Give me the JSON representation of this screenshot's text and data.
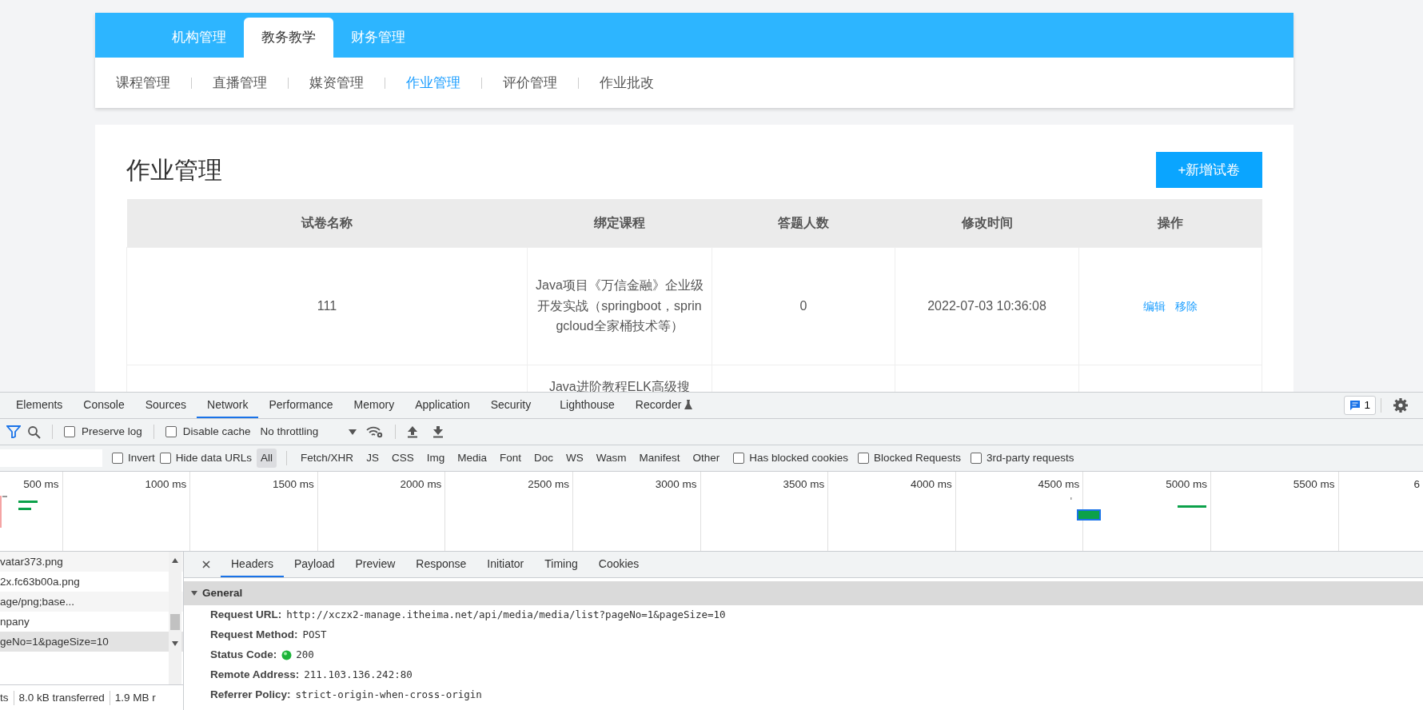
{
  "top_tabs": [
    {
      "label": "机构管理",
      "selected": false
    },
    {
      "label": "教务教学",
      "selected": true
    },
    {
      "label": "财务管理",
      "selected": false
    }
  ],
  "sub_nav": [
    {
      "label": "课程管理",
      "selected": false
    },
    {
      "label": "直播管理",
      "selected": false
    },
    {
      "label": "媒资管理",
      "selected": false
    },
    {
      "label": "作业管理",
      "selected": true
    },
    {
      "label": "评价管理",
      "selected": false
    },
    {
      "label": "作业批改",
      "selected": false
    }
  ],
  "page_title": "作业管理",
  "add_button": "+新增试卷",
  "table": {
    "columns": [
      "试卷名称",
      "绑定课程",
      "答题人数",
      "修改时间",
      "操作"
    ],
    "rows": [
      {
        "name": "111",
        "course": "Java项目《万信金融》企业级开发实战（springboot，springcloud全家桶技术等）",
        "answers": "0",
        "modified": "2022-07-03 10:36:08",
        "actions": [
          "编辑",
          "移除"
        ]
      },
      {
        "course": "Java进阶教程ELK高级搜"
      }
    ]
  },
  "devtools": {
    "tabs": [
      {
        "label": "Elements",
        "selected": false
      },
      {
        "label": "Console",
        "selected": false
      },
      {
        "label": "Sources",
        "selected": false
      },
      {
        "label": "Network",
        "selected": true
      },
      {
        "label": "Performance",
        "selected": false
      },
      {
        "label": "Memory",
        "selected": false
      },
      {
        "label": "Application",
        "selected": false
      },
      {
        "label": "Security",
        "selected": false
      },
      {
        "label": "Lighthouse",
        "selected": false
      },
      {
        "label": "Recorder",
        "selected": false
      }
    ],
    "issues_count": "1",
    "toolbar": {
      "options": [
        {
          "label": "Preserve log",
          "checked": false
        },
        {
          "label": "Disable cache",
          "checked": false
        }
      ],
      "throttling": "No throttling"
    },
    "filter_bar": {
      "options": [
        {
          "label": "Invert",
          "checked": false
        },
        {
          "label": "Hide data URLs",
          "checked": false
        }
      ],
      "types": [
        {
          "label": "All",
          "selected": true
        },
        {
          "label": "Fetch/XHR",
          "selected": false
        },
        {
          "label": "JS",
          "selected": false
        },
        {
          "label": "CSS",
          "selected": false
        },
        {
          "label": "Img",
          "selected": false
        },
        {
          "label": "Media",
          "selected": false
        },
        {
          "label": "Font",
          "selected": false
        },
        {
          "label": "Doc",
          "selected": false
        },
        {
          "label": "WS",
          "selected": false
        },
        {
          "label": "Wasm",
          "selected": false
        },
        {
          "label": "Manifest",
          "selected": false
        },
        {
          "label": "Other",
          "selected": false
        }
      ],
      "extra_options": [
        {
          "label": "Has blocked cookies",
          "checked": false
        },
        {
          "label": "Blocked Requests",
          "checked": false
        },
        {
          "label": "3rd-party requests",
          "checked": false
        }
      ]
    },
    "timeline": {
      "ticks": [
        "500 ms",
        "1000 ms",
        "1500 ms",
        "2000 ms",
        "2500 ms",
        "3000 ms",
        "3500 ms",
        "4000 ms",
        "4500 ms",
        "5000 ms",
        "5500 ms",
        "6"
      ]
    },
    "requests": [
      {
        "name": "vatar373.png",
        "selected": false
      },
      {
        "name": "2x.fc63b00a.png",
        "selected": false
      },
      {
        "name": "age/png;base...",
        "selected": false
      },
      {
        "name": "npany",
        "selected": false
      },
      {
        "name": "geNo=1&pageSize=10",
        "selected": true
      }
    ],
    "summary": [
      "ts",
      "8.0 kB transferred",
      "1.9 MB r"
    ],
    "detail_tabs": [
      {
        "label": "Headers",
        "selected": true
      },
      {
        "label": "Payload",
        "selected": false
      },
      {
        "label": "Preview",
        "selected": false
      },
      {
        "label": "Response",
        "selected": false
      },
      {
        "label": "Initiator",
        "selected": false
      },
      {
        "label": "Timing",
        "selected": false
      },
      {
        "label": "Cookies",
        "selected": false
      }
    ],
    "general": {
      "title": "General",
      "expanded": true,
      "fields": [
        {
          "label": "Request URL:",
          "value": "http://xczx2-manage.itheima.net/api/media/media/list?pageNo=1&pageSize=10"
        },
        {
          "label": "Request Method:",
          "value": "POST"
        },
        {
          "label": "Status Code:",
          "value": "200",
          "kind": "status"
        },
        {
          "label": "Remote Address:",
          "value": "211.103.136.242:80"
        },
        {
          "label": "Referrer Policy:",
          "value": "strict-origin-when-cross-origin"
        }
      ]
    }
  }
}
